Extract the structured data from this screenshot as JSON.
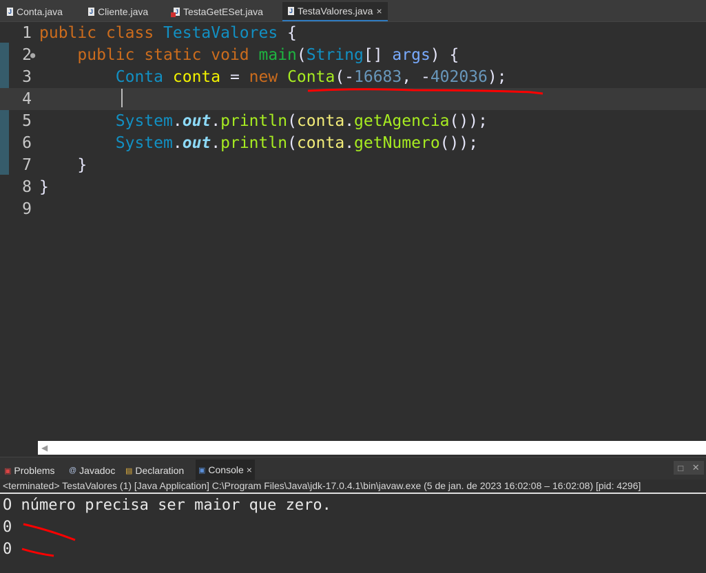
{
  "tabs": [
    {
      "label": "Conta.java",
      "error": false
    },
    {
      "label": "Cliente.java",
      "error": false
    },
    {
      "label": "TestaGetESet.java",
      "error": true
    },
    {
      "label": "TestaValores.java",
      "active": true,
      "close": "×"
    }
  ],
  "colors": {
    "keyword": "#cc6c1d",
    "type": "#1290c3",
    "local": "#f2f200",
    "method": "#1eb540",
    "call": "#a7ec21",
    "number": "#6897bb",
    "field": "#8ddaf8",
    "param": "#79abff",
    "plain": "#e6e6fa",
    "var": "#f3ec79",
    "annotation": "#ff0000"
  },
  "code": [
    {
      "n": "1",
      "tokens": [
        [
          "public ",
          "keyword"
        ],
        [
          "class ",
          "keyword"
        ],
        [
          "TestaValores ",
          "type"
        ],
        [
          "{",
          "plain"
        ]
      ]
    },
    {
      "n": "2",
      "fold": true,
      "tokens": [
        [
          "    ",
          "plain"
        ],
        [
          "public ",
          "keyword"
        ],
        [
          "static ",
          "keyword"
        ],
        [
          "void ",
          "keyword"
        ],
        [
          "main",
          "method"
        ],
        [
          "(",
          "plain"
        ],
        [
          "String",
          "type"
        ],
        [
          "[] ",
          "plain"
        ],
        [
          "args",
          "param"
        ],
        [
          ") {",
          "plain"
        ]
      ]
    },
    {
      "n": "3",
      "tokens": [
        [
          "        ",
          "plain"
        ],
        [
          "Conta ",
          "type"
        ],
        [
          "conta ",
          "local"
        ],
        [
          "= ",
          "plain"
        ],
        [
          "new ",
          "keyword"
        ],
        [
          "Conta",
          "call"
        ],
        [
          "(-",
          "plain"
        ],
        [
          "16683",
          "number"
        ],
        [
          ", -",
          "plain"
        ],
        [
          "402036",
          "number"
        ],
        [
          ");",
          "plain"
        ]
      ]
    },
    {
      "n": "4",
      "current": true,
      "tokens": []
    },
    {
      "n": "5",
      "tokens": [
        [
          "        ",
          "plain"
        ],
        [
          "System",
          "type"
        ],
        [
          ".",
          "plain"
        ],
        [
          "out",
          "field"
        ],
        [
          ".",
          "plain"
        ],
        [
          "println",
          "call"
        ],
        [
          "(",
          "plain"
        ],
        [
          "conta",
          "var"
        ],
        [
          ".",
          "plain"
        ],
        [
          "getAgencia",
          "call"
        ],
        [
          "());",
          "plain"
        ]
      ]
    },
    {
      "n": "6",
      "tokens": [
        [
          "        ",
          "plain"
        ],
        [
          "System",
          "type"
        ],
        [
          ".",
          "plain"
        ],
        [
          "out",
          "field"
        ],
        [
          ".",
          "plain"
        ],
        [
          "println",
          "call"
        ],
        [
          "(",
          "plain"
        ],
        [
          "conta",
          "var"
        ],
        [
          ".",
          "plain"
        ],
        [
          "getNumero",
          "call"
        ],
        [
          "());",
          "plain"
        ]
      ]
    },
    {
      "n": "7",
      "tokens": [
        [
          "    ",
          "plain"
        ],
        [
          "}",
          "plain"
        ]
      ]
    },
    {
      "n": "8",
      "tokens": [
        [
          "}",
          "plain"
        ]
      ]
    },
    {
      "n": "9",
      "tokens": []
    }
  ],
  "panel": {
    "tabs": [
      "Problems",
      "Javadoc",
      "Declaration",
      "Console"
    ],
    "close": "×",
    "maximize": "□",
    "minimize": "✕"
  },
  "console": {
    "status": "<terminated> TestaValores (1) [Java Application] C:\\Program Files\\Java\\jdk-17.0.4.1\\bin\\javaw.exe  (5 de jan. de 2023 16:02:08 – 16:02:08) [pid: 4296]",
    "output": [
      "O número precisa ser maior que zero.",
      "0",
      "0"
    ]
  }
}
